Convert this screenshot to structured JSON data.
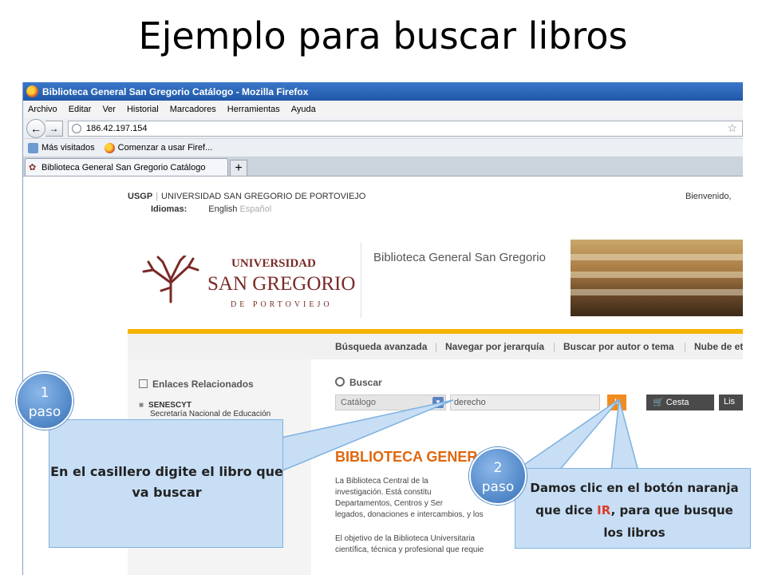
{
  "slide": {
    "title": "Ejemplo para buscar libros"
  },
  "browser": {
    "window_title": "Biblioteca General San Gregorio Catálogo - Mozilla Firefox",
    "menu": [
      "Archivo",
      "Editar",
      "Ver",
      "Historial",
      "Marcadores",
      "Herramientas",
      "Ayuda"
    ],
    "url": "186.42.197.154",
    "bookmarks": [
      "Más visitados",
      "Comenzar a usar Firef..."
    ],
    "tab_label": "Biblioteca General San Gregorio Catálogo"
  },
  "page": {
    "usgp": "USGP",
    "university_line": "UNIVERSIDAD SAN GREGORIO DE PORTOVIEJO",
    "idiomas_label": "Idiomas:",
    "lang_en": "English",
    "lang_es": "Español",
    "bienvenido": "Bienvenido,",
    "logo_universidad": "UNIVERSIDAD",
    "logo_san_gregorio": "SAN GREGORIO",
    "logo_portoviejo": "DE PORTOVIEJO",
    "library_name": "Biblioteca General San Gregorio",
    "nav": [
      "Búsqueda avanzada",
      "Navegar por jerarquía",
      "Buscar por autor o tema",
      "Nube de et"
    ],
    "enlaces_title": "Enlaces Relacionados",
    "senescyt_name": "SENESCYT",
    "senescyt_desc": "Secretaría Nacional de Educación",
    "buscar_label": "Buscar",
    "catalog_select": "Catálogo",
    "search_value": "derecho",
    "ir_button": "Ir",
    "cesta_button": "Cesta",
    "lista_button": "Lis",
    "heading": "BIBLIOTECA GENERAL",
    "para1": [
      "La Biblioteca Central de la",
      "investigación. Está constitu",
      "Departamentos, Centros y Ser",
      "legados, donaciones e intercambios, y los"
    ],
    "para2": [
      "El objetivo de la Biblioteca Universitaria",
      "científica, técnica y profesional que requie"
    ]
  },
  "annotations": {
    "step1_line1": "1",
    "step1_line2": "paso",
    "step1_text": "En el casillero digite el libro que va buscar",
    "step2_line1": "2",
    "step2_line2": "paso",
    "step2_text_before": "Damos clic en el botón naranja que dice ",
    "step2_text_ir": "IR",
    "step2_text_after": ", para que busque los libros",
    "accent_orange": "#f28c1e",
    "callout_fill": "#c7def5",
    "circle_fill": "#4f86c6"
  }
}
